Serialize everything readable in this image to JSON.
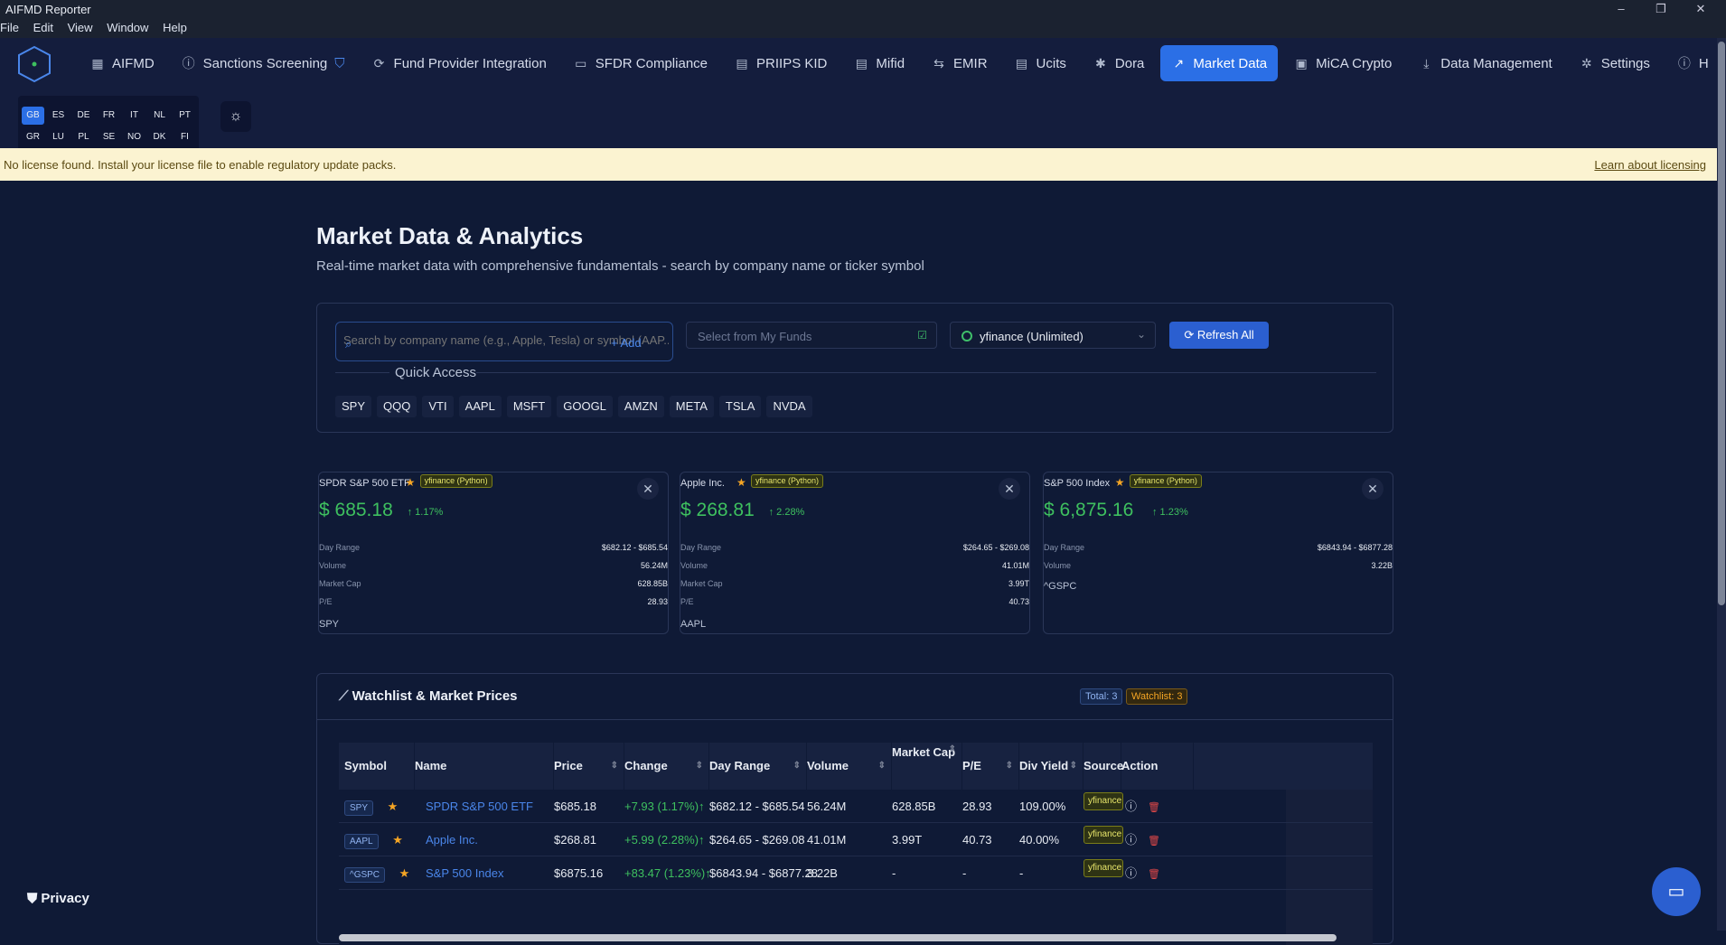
{
  "window": {
    "title": "AIFMD Reporter",
    "minimize": "–",
    "restore": "❐",
    "close": "✕"
  },
  "menu": [
    "File",
    "Edit",
    "View",
    "Window",
    "Help"
  ],
  "nav": [
    {
      "label": "AIFMD",
      "icon": "grid-icon",
      "glyph": "▦"
    },
    {
      "label": "Sanctions Screening",
      "icon": "info-icon",
      "glyph": "ⓘ"
    },
    {
      "label": "Fund Provider Integration",
      "icon": "sync-icon",
      "glyph": "⟳"
    },
    {
      "label": "SFDR Compliance",
      "icon": "folder-icon",
      "glyph": "▭"
    },
    {
      "label": "PRIIPS KID",
      "icon": "document-icon",
      "glyph": "▤"
    },
    {
      "label": "Mifid",
      "icon": "document-icon",
      "glyph": "▤"
    },
    {
      "label": "EMIR",
      "icon": "arrows-icon",
      "glyph": "⇆"
    },
    {
      "label": "Ucits",
      "icon": "document-icon",
      "glyph": "▤"
    },
    {
      "label": "Dora",
      "icon": "gear-icon",
      "glyph": "✱"
    },
    {
      "label": "Market Data",
      "icon": "trending-up-icon",
      "glyph": "↗",
      "active": true
    },
    {
      "label": "MiCA Crypto",
      "icon": "calculator-icon",
      "glyph": "▣"
    },
    {
      "label": "Data Management",
      "icon": "download-icon",
      "glyph": "⤓"
    },
    {
      "label": "Settings",
      "icon": "gear-icon",
      "glyph": "✲"
    },
    {
      "label": "H",
      "icon": "info-icon",
      "glyph": "ⓘ"
    }
  ],
  "langs": [
    "GB",
    "ES",
    "DE",
    "FR",
    "IT",
    "NL",
    "PT",
    "GR",
    "LU",
    "PL",
    "SE",
    "NO",
    "DK",
    "FI"
  ],
  "selected_lang": "GB",
  "theme_icon": "☼",
  "license": {
    "message": "No license found. Install your license file to enable regulatory update packs.",
    "link": "Learn about licensing"
  },
  "page": {
    "title": "Market Data & Analytics",
    "subtitle": "Real-time market data with comprehensive fundamentals - search by company name or ticker symbol"
  },
  "search": {
    "placeholder": "Search by company name (e.g., Apple, Tesla) or symbol (AAP...",
    "add": "+ Add",
    "icon": "⌕"
  },
  "funds_select": {
    "placeholder": "Select from My Funds"
  },
  "provider_select": {
    "value": "yfinance (Unlimited)"
  },
  "refresh_label": "⟳  Refresh All",
  "quick_access": {
    "label": "Quick Access",
    "symbols": [
      "SPY",
      "QQQ",
      "VTI",
      "AAPL",
      "MSFT",
      "GOOGL",
      "AMZN",
      "META",
      "TSLA",
      "NVDA"
    ]
  },
  "cards": [
    {
      "name": "SPDR S&P 500 ETF",
      "source": "yfinance (Python)",
      "price": "$ 685.18",
      "change": "↑ 1.17%",
      "symbol": "SPY",
      "rows": [
        {
          "k": "Day Range",
          "v": "$682.12 - $685.54"
        },
        {
          "k": "Volume",
          "v": "56.24M"
        },
        {
          "k": "Market Cap",
          "v": "628.85B"
        },
        {
          "k": "P/E",
          "v": "28.93"
        }
      ]
    },
    {
      "name": "Apple Inc.",
      "source": "yfinance (Python)",
      "price": "$ 268.81",
      "change": "↑ 2.28%",
      "symbol": "AAPL",
      "rows": [
        {
          "k": "Day Range",
          "v": "$264.65 - $269.08"
        },
        {
          "k": "Volume",
          "v": "41.01M"
        },
        {
          "k": "Market Cap",
          "v": "3.99T"
        },
        {
          "k": "P/E",
          "v": "40.73"
        }
      ]
    },
    {
      "name": "S&P 500 Index",
      "source": "yfinance (Python)",
      "price": "$ 6,875.16",
      "change": "↑ 1.23%",
      "symbol": "^GSPC",
      "rows": [
        {
          "k": "Day Range",
          "v": "$6843.94 - $6877.28"
        },
        {
          "k": "Volume",
          "v": "3.22B"
        }
      ]
    }
  ],
  "watchlist": {
    "title": "Watchlist & Market Prices",
    "total": "Total: 3",
    "watch": "Watchlist: 3",
    "columns": [
      "Symbol",
      "Name",
      "Price",
      "Change",
      "Day Range",
      "Volume",
      "Market Cap",
      "P/E",
      "Div Yield",
      "Source",
      "Action"
    ],
    "rows": [
      {
        "symbol": "SPY",
        "name": "SPDR S&P 500 ETF",
        "price": "$685.18",
        "change": "+7.93 (1.17%)↑",
        "range": "$682.12 - $685.54",
        "volume": "56.24M",
        "cap": "628.85B",
        "pe": "28.93",
        "div": "109.00%",
        "source": "yfinance"
      },
      {
        "symbol": "AAPL",
        "name": "Apple Inc.",
        "price": "$268.81",
        "change": "+5.99 (2.28%)↑",
        "range": "$264.65 - $269.08",
        "volume": "41.01M",
        "cap": "3.99T",
        "pe": "40.73",
        "div": "40.00%",
        "source": "yfinance"
      },
      {
        "symbol": "^GSPC",
        "name": "S&P 500 Index",
        "price": "$6875.16",
        "change": "+83.47 (1.23%)↑",
        "range": "$6843.94 - $6877.28",
        "volume": "3.22B",
        "cap": "-",
        "pe": "-",
        "div": "-",
        "source": "yfinance"
      }
    ]
  },
  "privacy": "Privacy",
  "colors": {
    "accent": "#2b6fe6",
    "positive": "#3ec05f",
    "star": "#f5a524"
  }
}
